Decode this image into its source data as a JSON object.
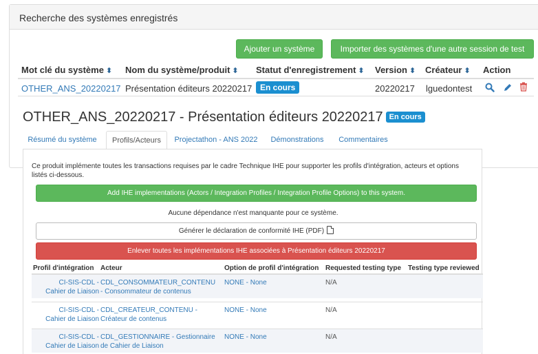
{
  "panel": {
    "title": "Recherche des systèmes enregistrés"
  },
  "buttons": {
    "add_system": "Ajouter un système",
    "import_systems": "Importer des systèmes d'une autre session de test"
  },
  "table": {
    "headers": [
      "Mot clé du système",
      "Nom du système/produit",
      "Statut d'enregistrement",
      "Version",
      "Créateur",
      "Action"
    ],
    "sort_glyph": "⬍",
    "row": {
      "keyword": "OTHER_ANS_20220217",
      "name": "Présentation éditeurs 20220217",
      "status": "En cours",
      "version": "20220217",
      "creator": "lguedontest"
    }
  },
  "icons": {
    "search": "search-icon",
    "edit": "pencil-icon",
    "delete": "trash-icon",
    "pdf": "file-pdf-icon",
    "colors": {
      "search": "#337ab7",
      "edit": "#337ab7",
      "delete": "#d9534f"
    }
  },
  "system": {
    "title": "OTHER_ANS_20220217 - Présentation éditeurs 20220217",
    "badge": "En cours"
  },
  "tabs": [
    {
      "label": "Résumé du système",
      "active": false
    },
    {
      "label": "Profils/Acteurs",
      "active": true
    },
    {
      "label": "Projectathon - ANS 2022",
      "active": false
    },
    {
      "label": "Démonstrations",
      "active": false
    },
    {
      "label": "Commentaires",
      "active": false
    }
  ],
  "profiles": {
    "description": "Ce produit implémente toutes les transactions requises par le cadre Technique IHE pour supporter les profils d'intégration, acteurs et options listés ci-dessous.",
    "add_button": "Add IHE implementations (Actors / Integration Profiles / Integration Profile Options) to this system.",
    "dependency_note": "Aucune dépendance n'est manquante pour ce système.",
    "generate_button": "Générer le déclaration de conformité IHE (PDF)",
    "remove_button": "Enlever toutes les implémentations IHE associées à Présentation éditeurs 20220217",
    "headers": [
      "Profil d'intégration",
      "Acteur",
      "Option de profil d'intégration",
      "Requested testing type",
      "Testing type reviewed"
    ],
    "rows": [
      {
        "profile_1": "CI-SIS-CDL -",
        "profile_2": "Cahier de Liaison",
        "actor_1": "CDL_CONSOMMATEUR_CONTENU",
        "actor_2": "- Consommateur de contenus",
        "option": "NONE - None",
        "requested": "N/A"
      },
      {
        "profile_1": "CI-SIS-CDL -",
        "profile_2": "Cahier de Liaison",
        "actor_1": "CDL_CREATEUR_CONTENU -",
        "actor_2": "Créateur de contenus",
        "option": "NONE - None",
        "requested": "N/A"
      },
      {
        "profile_1": "CI-SIS-CDL -",
        "profile_2": "Cahier de Liaison",
        "actor_1": "CDL_GESTIONNAIRE - Gestionnaire",
        "actor_2": "de Cahier de Liaison",
        "option": "NONE - None",
        "requested": "N/A"
      }
    ]
  }
}
